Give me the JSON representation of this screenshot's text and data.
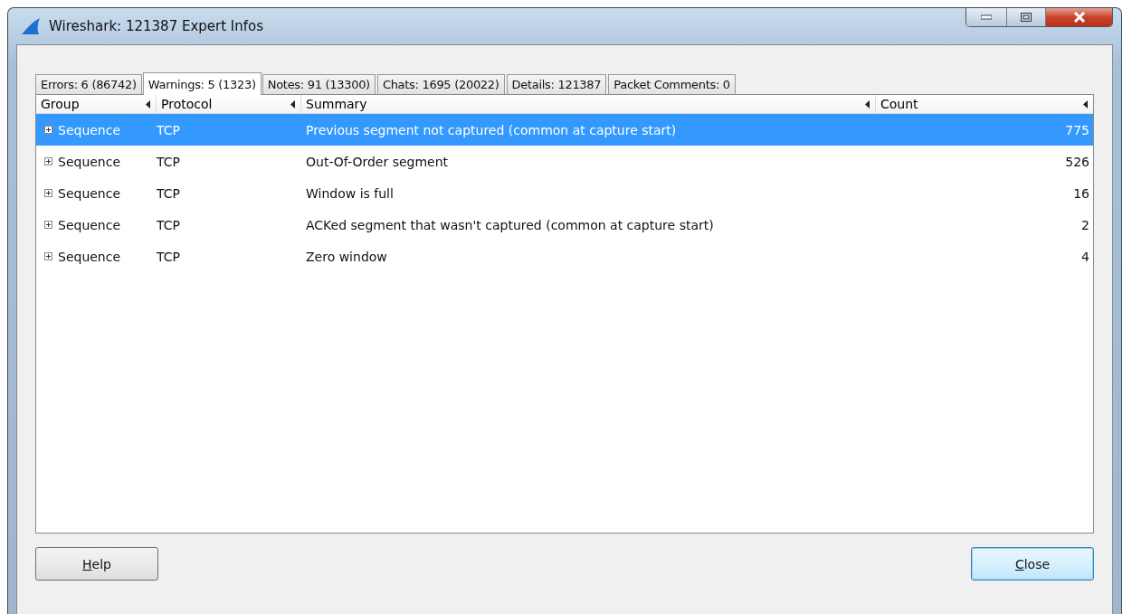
{
  "window": {
    "title": "Wireshark: 121387 Expert Infos"
  },
  "tabs": [
    {
      "label": "Errors: 6 (86742)",
      "selected": false
    },
    {
      "label": "Warnings: 5 (1323)",
      "selected": true
    },
    {
      "label": "Notes: 91 (13300)",
      "selected": false
    },
    {
      "label": "Chats: 1695 (20022)",
      "selected": false
    },
    {
      "label": "Details: 121387",
      "selected": false
    },
    {
      "label": "Packet Comments: 0",
      "selected": false
    }
  ],
  "table": {
    "columns": [
      "Group",
      "Protocol",
      "Summary",
      "Count"
    ],
    "rows": [
      {
        "group": "Sequence",
        "protocol": "TCP",
        "summary": "Previous segment not captured (common at capture start)",
        "count": "775",
        "selected": true,
        "expanded": false
      },
      {
        "group": "Sequence",
        "protocol": "TCP",
        "summary": "Out-Of-Order segment",
        "count": "526",
        "selected": false,
        "expanded": false
      },
      {
        "group": "Sequence",
        "protocol": "TCP",
        "summary": "Window is full",
        "count": "16",
        "selected": false,
        "expanded": false
      },
      {
        "group": "Sequence",
        "protocol": "TCP",
        "summary": "ACKed segment that wasn't captured (common at capture start)",
        "count": "2",
        "selected": false,
        "expanded": false
      },
      {
        "group": "Sequence",
        "protocol": "TCP",
        "summary": "Zero window",
        "count": "4",
        "selected": false,
        "expanded": false
      }
    ]
  },
  "buttons": [
    {
      "label": "Help"
    },
    {
      "label": "Close"
    }
  ]
}
